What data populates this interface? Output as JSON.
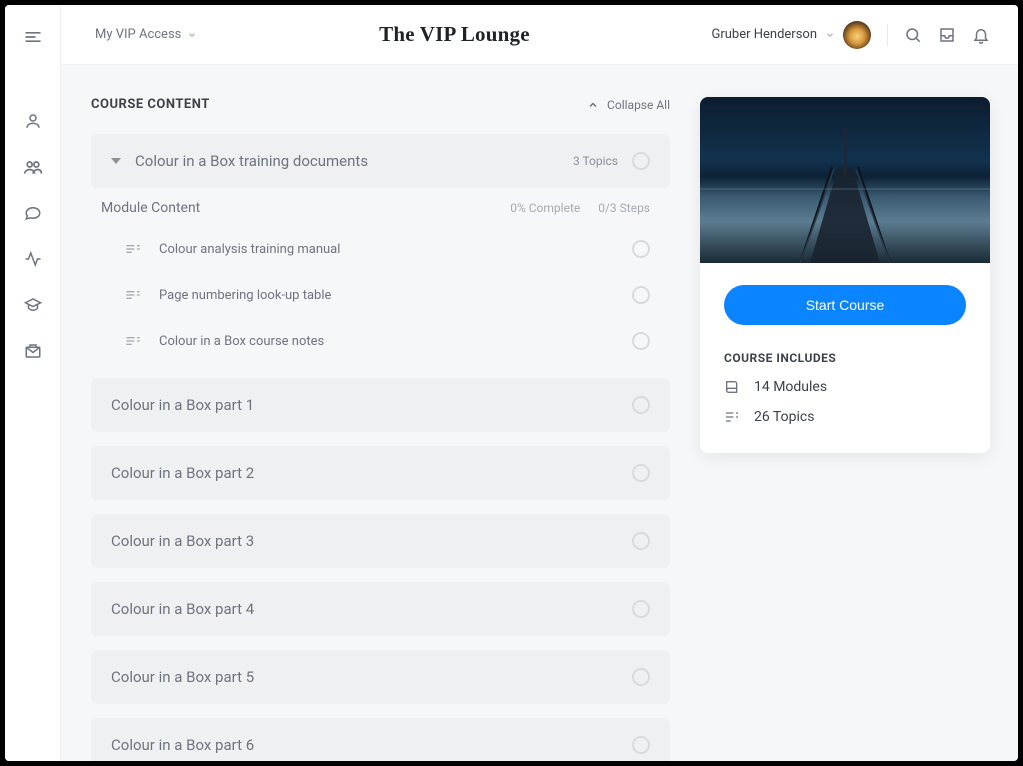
{
  "header": {
    "access_label": "My VIP Access",
    "site_title": "The VIP Lounge",
    "user_name": "Gruber Henderson"
  },
  "section": {
    "title": "COURSE CONTENT",
    "collapse_label": "Collapse All"
  },
  "modules": {
    "expanded": {
      "title": "Colour in a Box training documents",
      "meta": "3 Topics",
      "children_title": "Module Content",
      "progress": "0% Complete",
      "steps": "0/3 Steps",
      "topics": [
        {
          "label": "Colour analysis training manual"
        },
        {
          "label": "Page numbering look-up table"
        },
        {
          "label": "Colour in a Box course notes"
        }
      ]
    },
    "collapsed": [
      {
        "title": "Colour in a Box part 1"
      },
      {
        "title": "Colour in a Box part 2"
      },
      {
        "title": "Colour in a Box part 3"
      },
      {
        "title": "Colour in a Box part 4"
      },
      {
        "title": "Colour in a Box part 5"
      },
      {
        "title": "Colour in a Box part 6"
      }
    ]
  },
  "sidebar": {
    "cta": "Start Course",
    "includes_title": "COURSE INCLUDES",
    "rows": [
      {
        "label": "14 Modules"
      },
      {
        "label": "26 Topics"
      }
    ]
  }
}
